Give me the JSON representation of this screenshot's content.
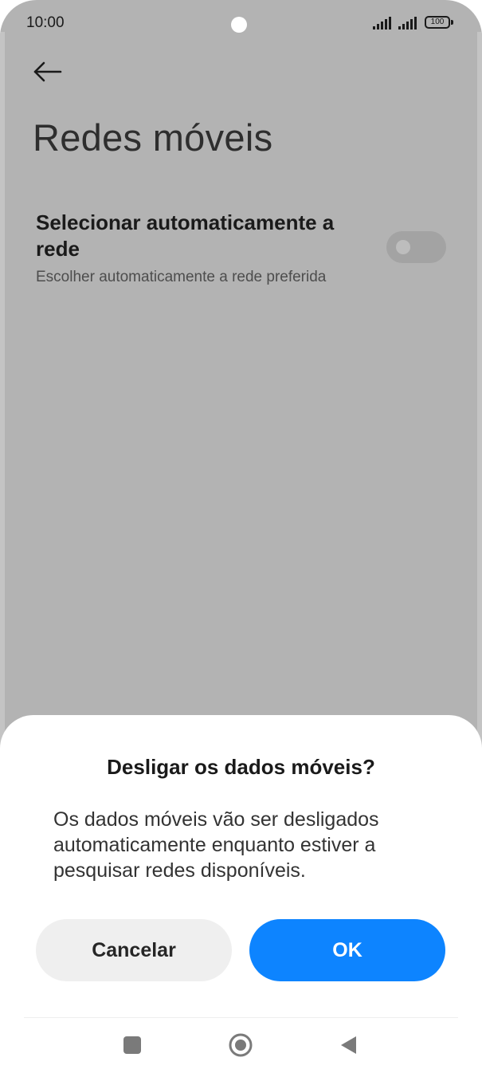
{
  "status_bar": {
    "time": "10:00",
    "battery": "100"
  },
  "header": {
    "back_icon": "arrow-left-icon",
    "title": "Redes móveis"
  },
  "setting": {
    "title": "Selecionar automaticamente a rede",
    "subtitle": "Escolher automaticamente a rede preferida",
    "toggle_on": false
  },
  "dialog": {
    "title": "Desligar os dados móveis?",
    "message": "Os dados móveis vão ser desligados automaticamente enquanto estiver a pesquisar redes disponíveis.",
    "cancel_label": "Cancelar",
    "ok_label": "OK",
    "ok_color": "#0d84ff"
  },
  "nav_bar": {
    "icons": [
      "recents-square-icon",
      "home-circle-icon",
      "back-triangle-icon"
    ]
  }
}
